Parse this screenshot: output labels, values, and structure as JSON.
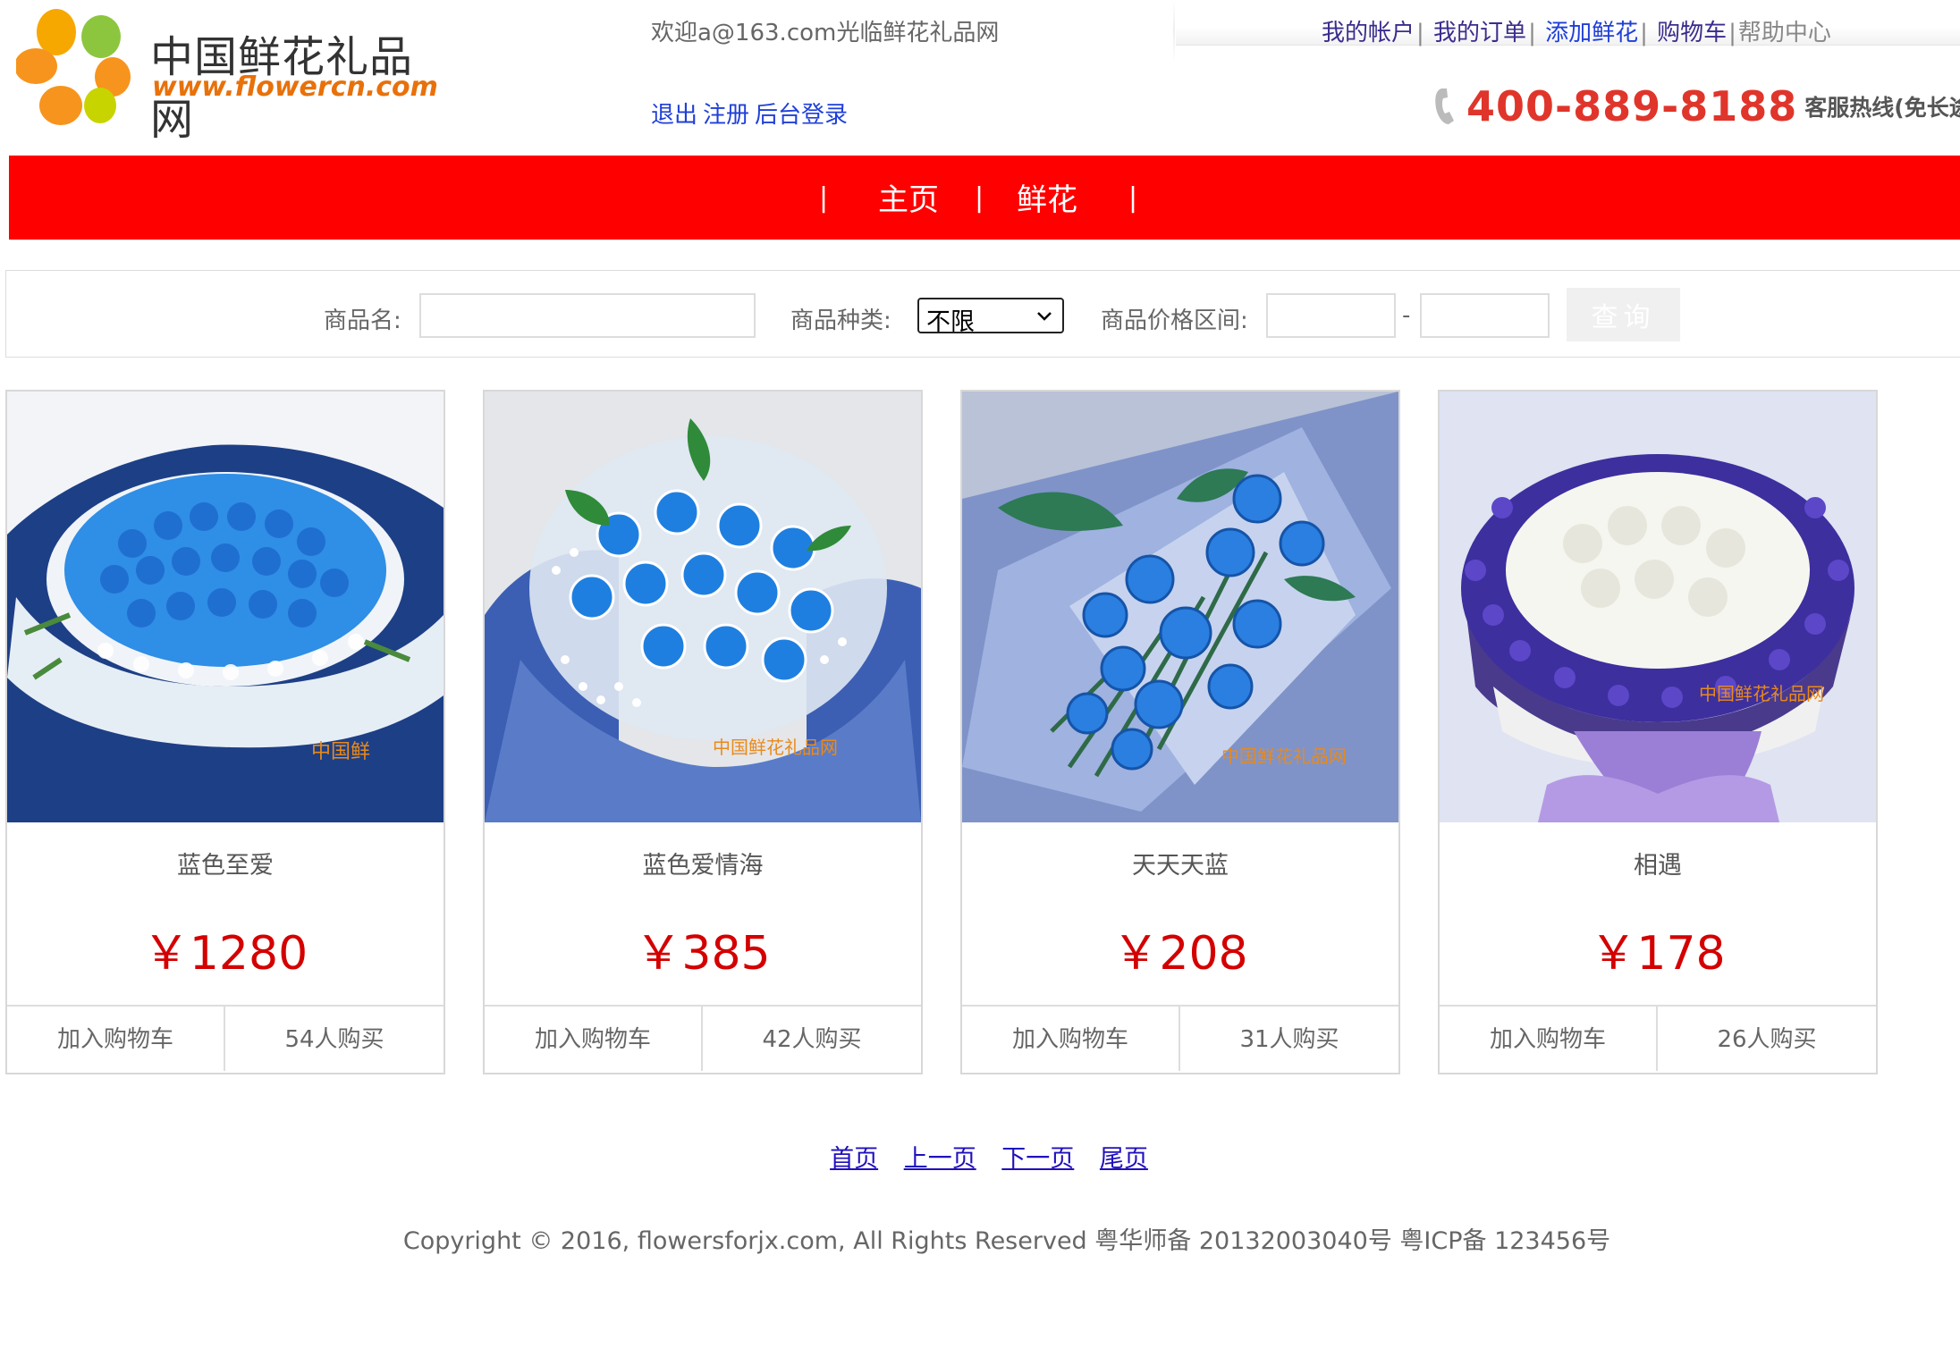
{
  "header": {
    "logo_cn": "中国鲜花礼品网",
    "logo_en": "www.flowercn.com",
    "welcome": "欢迎a@163.com光临鲜花礼品网",
    "auth_links": [
      "退出",
      "注册",
      "后台登录"
    ],
    "top_nav": {
      "my_account": "我的帐户",
      "my_orders": "我的订单",
      "add_flower": "添加鲜花",
      "cart": "购物车",
      "help": "帮助中心"
    },
    "hotline_number": "400-889-8188",
    "hotline_desc": "客服热线(免长途费)"
  },
  "navbar": {
    "home": "主页",
    "flowers": "鲜花"
  },
  "search": {
    "name_label": "商品名:",
    "name_value": "",
    "category_label": "商品种类:",
    "category_value": "不限",
    "price_label": "商品价格区间:",
    "price_min": "",
    "price_max": "",
    "separator": "-",
    "query_button": "查询"
  },
  "products": [
    {
      "name": "蓝色至爱",
      "price": "￥1280",
      "cart_label": "加入购物车",
      "buyers": "54人购买"
    },
    {
      "name": "蓝色爱情海",
      "price": "￥385",
      "cart_label": "加入购物车",
      "buyers": "42人购买"
    },
    {
      "name": "天天天蓝",
      "price": "￥208",
      "cart_label": "加入购物车",
      "buyers": "31人购买"
    },
    {
      "name": "相遇",
      "price": "￥178",
      "cart_label": "加入购物车",
      "buyers": "26人购买"
    }
  ],
  "pagination": {
    "first": "首页",
    "prev": "上一页",
    "next": "下一页",
    "last": "尾页"
  },
  "footer": {
    "copyright": "Copyright © 2016, flowersforjx.com, All Rights Reserved 粤华师备 20132003040号 粤ICP备 123456号"
  },
  "colors": {
    "navbar_bg": "#ff0000",
    "price": "#d40000",
    "link": "#1f3fd8",
    "hotline": "#e0352b"
  }
}
